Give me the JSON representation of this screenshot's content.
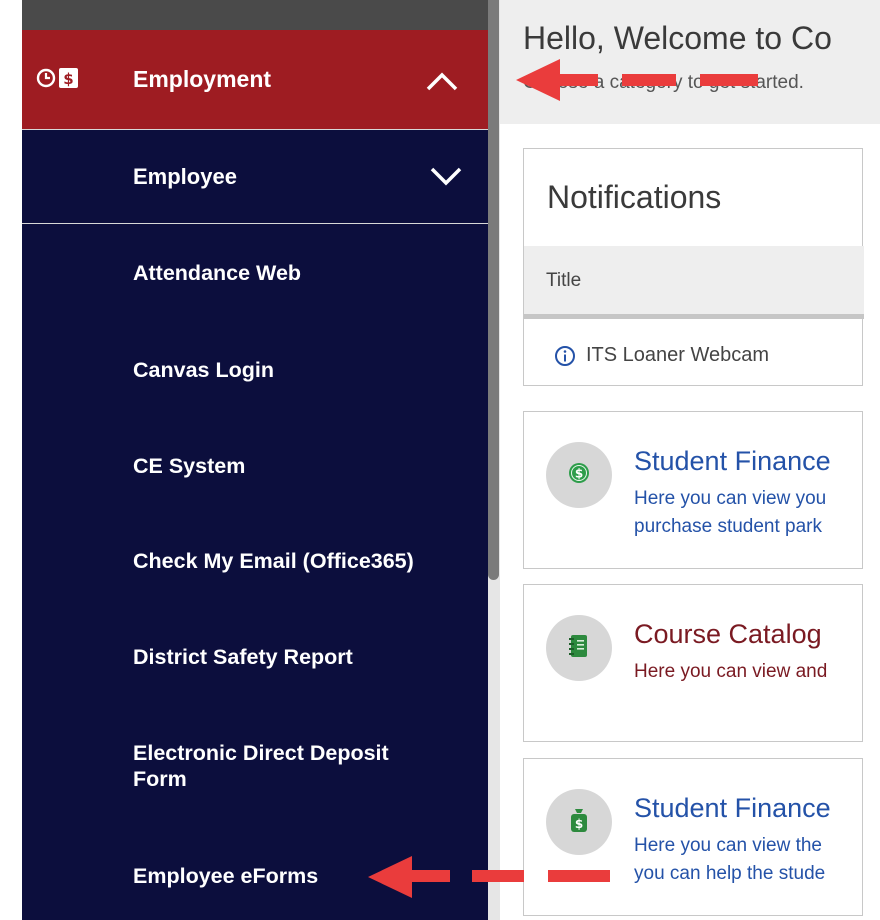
{
  "sidebar": {
    "section": {
      "label": "Employment",
      "icon": "clock-dollar-icon"
    },
    "subsection": {
      "label": "Employee"
    },
    "items": [
      {
        "label": "Attendance Web"
      },
      {
        "label": "Canvas Login"
      },
      {
        "label": "CE System"
      },
      {
        "label": "Check My Email (Office365)"
      },
      {
        "label": "District Safety Report"
      },
      {
        "label": "Electronic Direct Deposit Form"
      },
      {
        "label": "Employee eForms"
      }
    ]
  },
  "header": {
    "greeting": "Hello, Welcome to Co",
    "subtitle": "Choose a category to get started."
  },
  "notifications": {
    "title": "Notifications",
    "column_title": "Title",
    "rows": [
      {
        "label": "ITS Loaner Webcam"
      }
    ]
  },
  "tiles": [
    {
      "title": "Student Finance",
      "desc1": "Here you can view you",
      "desc2": "purchase student park",
      "title_color": "#2452a8",
      "icon": "dollar-coin-icon"
    },
    {
      "title": "Course Catalog",
      "desc1": "Here you can view and",
      "desc2": "",
      "title_color": "#7a1a22",
      "icon": "notebook-icon"
    },
    {
      "title": "Student Finance",
      "desc1": "Here you can view the",
      "desc2": "you can help the stude",
      "title_color": "#2452a8",
      "icon": "money-bag-icon"
    }
  ],
  "colors": {
    "sidebar_bg": "#0c0e3d",
    "section_bg": "#9e1c22",
    "arrow": "#ea3c3c"
  }
}
